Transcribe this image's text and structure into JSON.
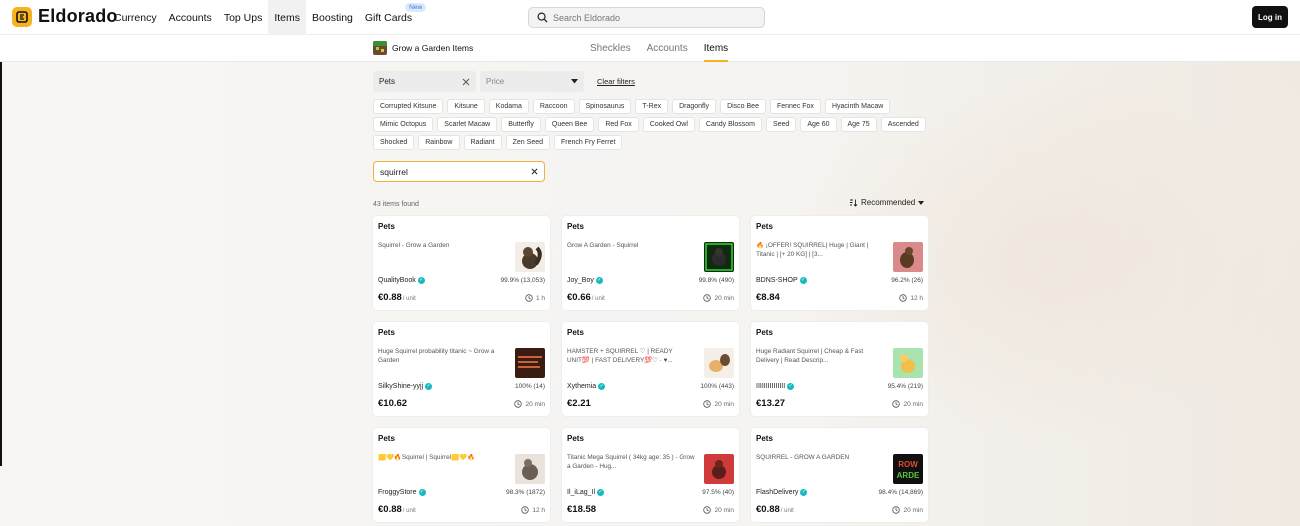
{
  "brand": {
    "name": "Eldorado"
  },
  "nav": {
    "links": [
      {
        "label": "Currency"
      },
      {
        "label": "Accounts"
      },
      {
        "label": "Top Ups"
      },
      {
        "label": "Items"
      },
      {
        "label": "Boosting"
      },
      {
        "label": "Gift Cards",
        "badge": "New"
      }
    ],
    "active": "Items",
    "search_placeholder": "Search Eldorado",
    "login_label": "Log in"
  },
  "subheader": {
    "game_name": "Grow a Garden Items",
    "tabs": [
      {
        "label": "Sheckles"
      },
      {
        "label": "Accounts"
      },
      {
        "label": "Items"
      }
    ],
    "active_tab": "Items"
  },
  "filters": {
    "category_value": "Pets",
    "price_placeholder": "Price",
    "clear_label": "Clear filters",
    "chips": [
      "Corrupted Kitsune",
      "Kitsune",
      "Kodama",
      "Raccoon",
      "Spinosaurus",
      "T-Rex",
      "Dragonfly",
      "Disco Bee",
      "Fennec Fox",
      "Hyacinth Macaw",
      "Mimic Octopus",
      "Scarlet Macaw",
      "Butterfly",
      "Queen Bee",
      "Red Fox",
      "Cooked Owl",
      "Candy Blossom",
      "Seed",
      "Age 60",
      "Age 75",
      "Ascended",
      "Shocked",
      "Rainbow",
      "Radiant",
      "Zen Seed",
      "French Fry Ferret"
    ],
    "query_value": "squirrel"
  },
  "results": {
    "count_text": "43 items found",
    "sort_label": "Recommended",
    "cards": [
      {
        "category": "Pets",
        "title": "Squirrel - Grow a Garden",
        "seller": "QualityBook",
        "rating": "99.9% (13,053)",
        "price": "€0.88",
        "unit": "/ unit",
        "time": "1 h",
        "thumb": "squirrel-brown"
      },
      {
        "category": "Pets",
        "title": "Grow A Garden - Squirrel",
        "seller": "Joy_Boy",
        "rating": "99.8% (490)",
        "price": "€0.66",
        "unit": "/ unit",
        "time": "20 min",
        "thumb": "squirrel-green-neon"
      },
      {
        "category": "Pets",
        "title": "🔥 ¡OFFER! SQUIRREL| Huge | Giant | Titanic | [+ 20 KG] | [3...",
        "seller": "BDNS-SHOP",
        "rating": "96.2% (26)",
        "price": "€8.84",
        "unit": "",
        "time": "12 h",
        "thumb": "squirrel-pink"
      },
      {
        "category": "Pets",
        "title": "Huge Squirrel probability titanic ~ Grow a Garden",
        "seller": "SilkyShine-yyjj",
        "rating": "100% (14)",
        "price": "€10.62",
        "unit": "",
        "time": "20 min",
        "thumb": "squirrel-dark-text"
      },
      {
        "category": "Pets",
        "title": "HAMSTER + SQUIRREL ♡ | READY UNIT💯 | FAST DELIVERY💯♡ · ♥...",
        "seller": "Xythemia",
        "rating": "100% (443)",
        "price": "€2.21",
        "unit": "",
        "time": "20 min",
        "thumb": "squirrel-hamster"
      },
      {
        "category": "Pets",
        "title": "Huge Radiant Squirrel | Cheap & Fast Delivery | Read Descrip...",
        "seller": "IIIIIIIIIIIIIII",
        "rating": "95.4% (219)",
        "price": "€13.27",
        "unit": "",
        "time": "20 min",
        "thumb": "squirrel-radiant"
      },
      {
        "category": "Pets",
        "title": "🟨💛🔥Squirrel | Squirrel🟨💛🔥",
        "seller": "FroggyStore",
        "rating": "98.3% (1872)",
        "price": "€0.88",
        "unit": "/ unit",
        "time": "12 h",
        "thumb": "squirrel-grey"
      },
      {
        "category": "Pets",
        "title": "Titanic Mega Squirrel ( 34kg age: 35 ) - Grow a Garden - Hug...",
        "seller": "Il_iLag_Il",
        "rating": "97.5% (40)",
        "price": "€18.58",
        "unit": "",
        "time": "20 min",
        "thumb": "squirrel-red"
      },
      {
        "category": "Pets",
        "title": "SQUIRREL - GROW A GARDEN",
        "seller": "FlashDelivery",
        "rating": "98.4% (14,869)",
        "price": "€0.88",
        "unit": "/ unit",
        "time": "20 min",
        "thumb": "grow-a-garden-logo",
        "thumb_text": "ROW\nARDE"
      }
    ]
  }
}
